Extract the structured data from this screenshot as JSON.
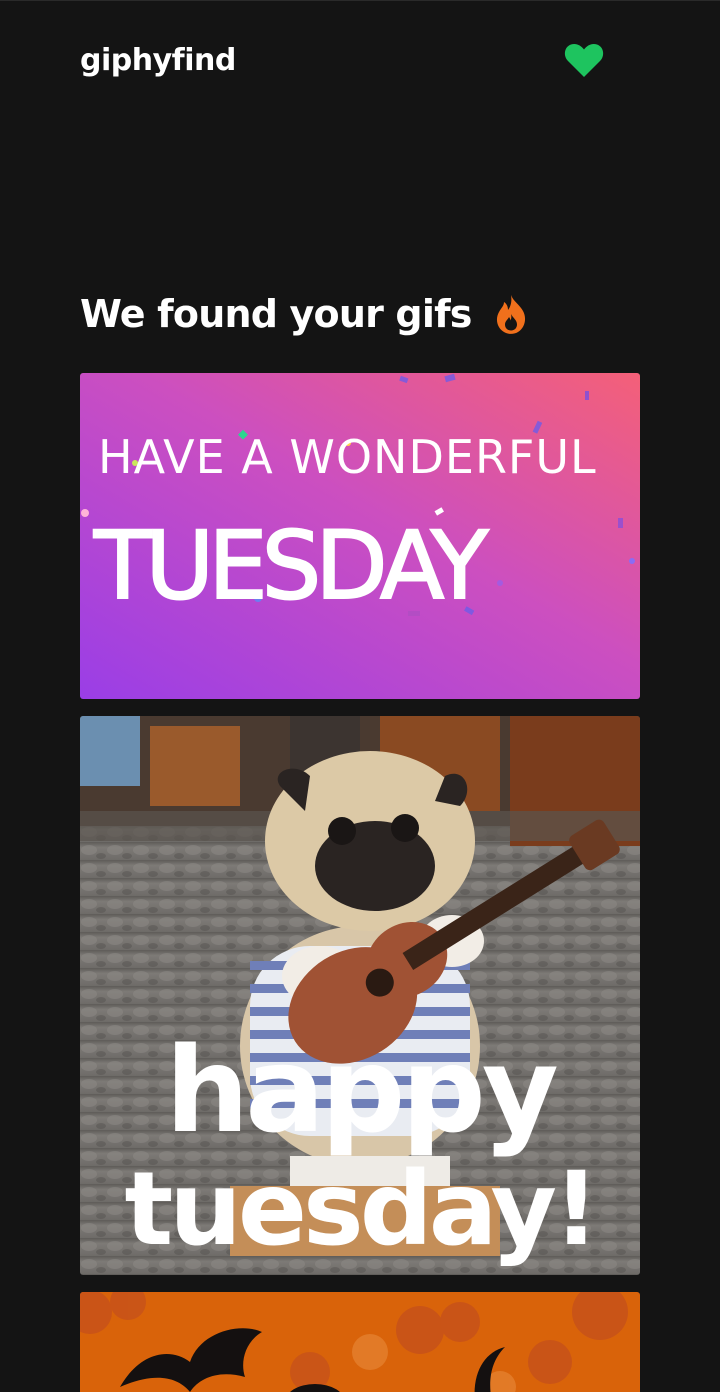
{
  "header": {
    "logo": "giphyfind",
    "favorites_icon": "heart-icon",
    "favorites_color": "#1ec45f"
  },
  "results": {
    "heading": "We found your gifs",
    "heading_icon": "fire-icon",
    "heading_icon_color": "#f0701c"
  },
  "gifs": [
    {
      "line1": "HAVE A WONDERFUL",
      "line2": "TUESDAY",
      "gradient_start": "#9a3ee6",
      "gradient_end": "#f46078"
    },
    {
      "line1": "happy",
      "line2": "tuesday!"
    },
    {
      "background": "#d9630a"
    }
  ]
}
